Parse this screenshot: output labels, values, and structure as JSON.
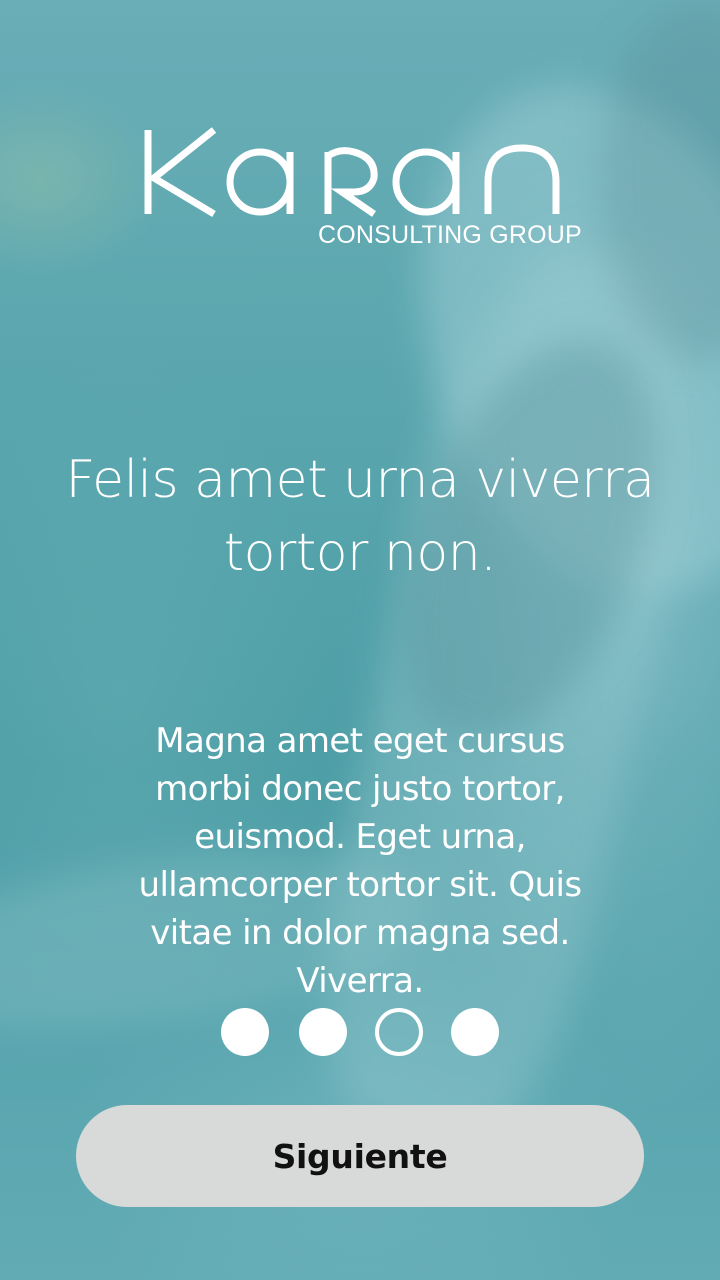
{
  "logo": {
    "wordmark": "KARAN",
    "subtitle": "CONSULTING GROUP"
  },
  "onboarding": {
    "headline": "Felis amet urna viverra tortor non.",
    "description": "Magna amet eget cursus morbi donec justo tortor, euismod. Eget urna, ullamcorper tortor sit. Quis vitae in dolor magna sed. Viverra.",
    "pager": {
      "total": 4,
      "current": 3
    }
  },
  "actions": {
    "next_label": "Siguiente"
  },
  "colors": {
    "background_tint": "#4d9fa8",
    "text": "#ffffff",
    "button_bg": "#d8d9d9",
    "button_text": "#111111"
  }
}
